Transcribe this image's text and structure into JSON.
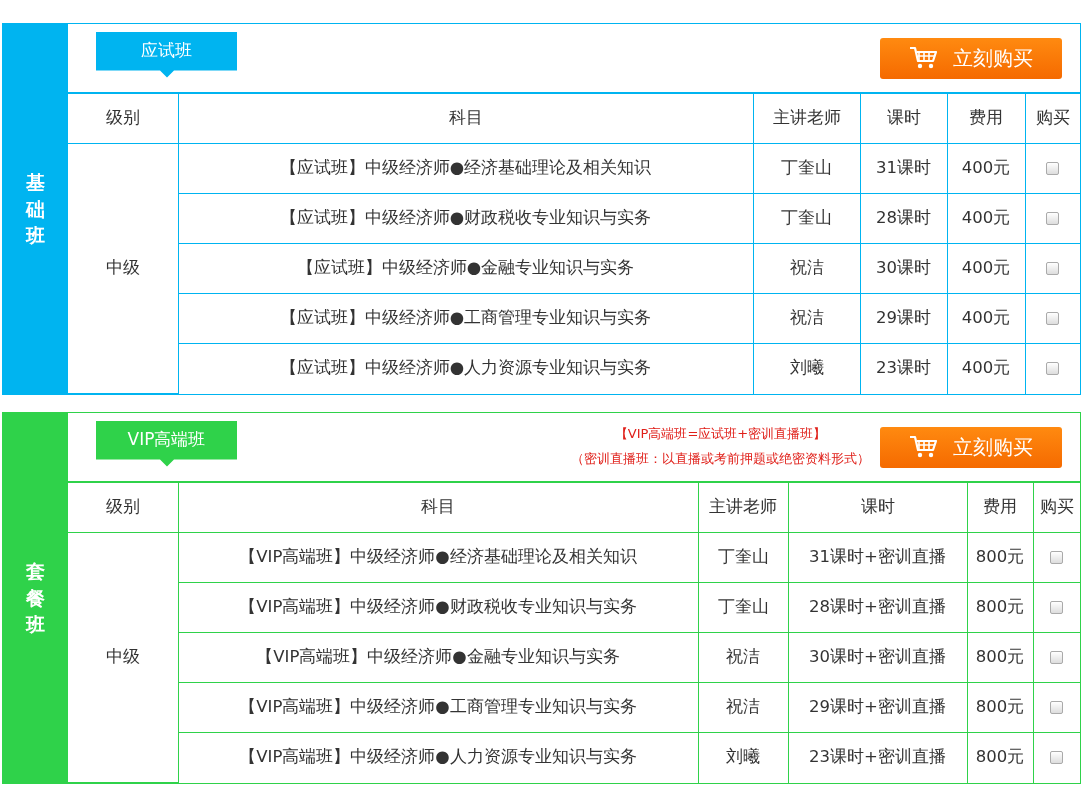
{
  "sections": [
    {
      "side_label": "基础班",
      "color": "#00b4f0",
      "tag": "应试班",
      "buy_button": "立刻购买",
      "columns": [
        "级别",
        "科目",
        "主讲老师",
        "课时",
        "费用",
        "购买"
      ],
      "level": "中级",
      "rows": [
        {
          "subject": "【应试班】中级经济师●经济基础理论及相关知识",
          "teacher": "丁奎山",
          "hours": "31课时",
          "fee": "400元",
          "checked": false
        },
        {
          "subject": "【应试班】中级经济师●财政税收专业知识与实务",
          "teacher": "丁奎山",
          "hours": "28课时",
          "fee": "400元",
          "checked": false
        },
        {
          "subject": "【应试班】中级经济师●金融专业知识与实务",
          "teacher": "祝洁",
          "hours": "30课时",
          "fee": "400元",
          "checked": false
        },
        {
          "subject": "【应试班】中级经济师●工商管理专业知识与实务",
          "teacher": "祝洁",
          "hours": "29课时",
          "fee": "400元",
          "checked": false
        },
        {
          "subject": "【应试班】中级经济师●人力资源专业知识与实务",
          "teacher": "刘曦",
          "hours": "23课时",
          "fee": "400元",
          "checked": false
        }
      ]
    },
    {
      "side_label": "套餐班",
      "color": "#2fd24a",
      "tag": "VIP高端班",
      "notes": [
        "【VIP高端班=应试班+密训直播班】",
        "（密训直播班：以直播或考前押题或绝密资料形式）"
      ],
      "buy_button": "立刻购买",
      "columns": [
        "级别",
        "科目",
        "主讲老师",
        "课时",
        "费用",
        "购买"
      ],
      "level": "中级",
      "rows": [
        {
          "subject": "【VIP高端班】中级经济师●经济基础理论及相关知识",
          "teacher": "丁奎山",
          "hours": "31课时+密训直播",
          "fee": "800元",
          "checked": false
        },
        {
          "subject": "【VIP高端班】中级经济师●财政税收专业知识与实务",
          "teacher": "丁奎山",
          "hours": "28课时+密训直播",
          "fee": "800元",
          "checked": false
        },
        {
          "subject": "【VIP高端班】中级经济师●金融专业知识与实务",
          "teacher": "祝洁",
          "hours": "30课时+密训直播",
          "fee": "800元",
          "checked": false
        },
        {
          "subject": "【VIP高端班】中级经济师●工商管理专业知识与实务",
          "teacher": "祝洁",
          "hours": "29课时+密训直播",
          "fee": "800元",
          "checked": false
        },
        {
          "subject": "【VIP高端班】中级经济师●人力资源专业知识与实务",
          "teacher": "刘曦",
          "hours": "23课时+密训直播",
          "fee": "800元",
          "checked": false
        }
      ]
    }
  ]
}
